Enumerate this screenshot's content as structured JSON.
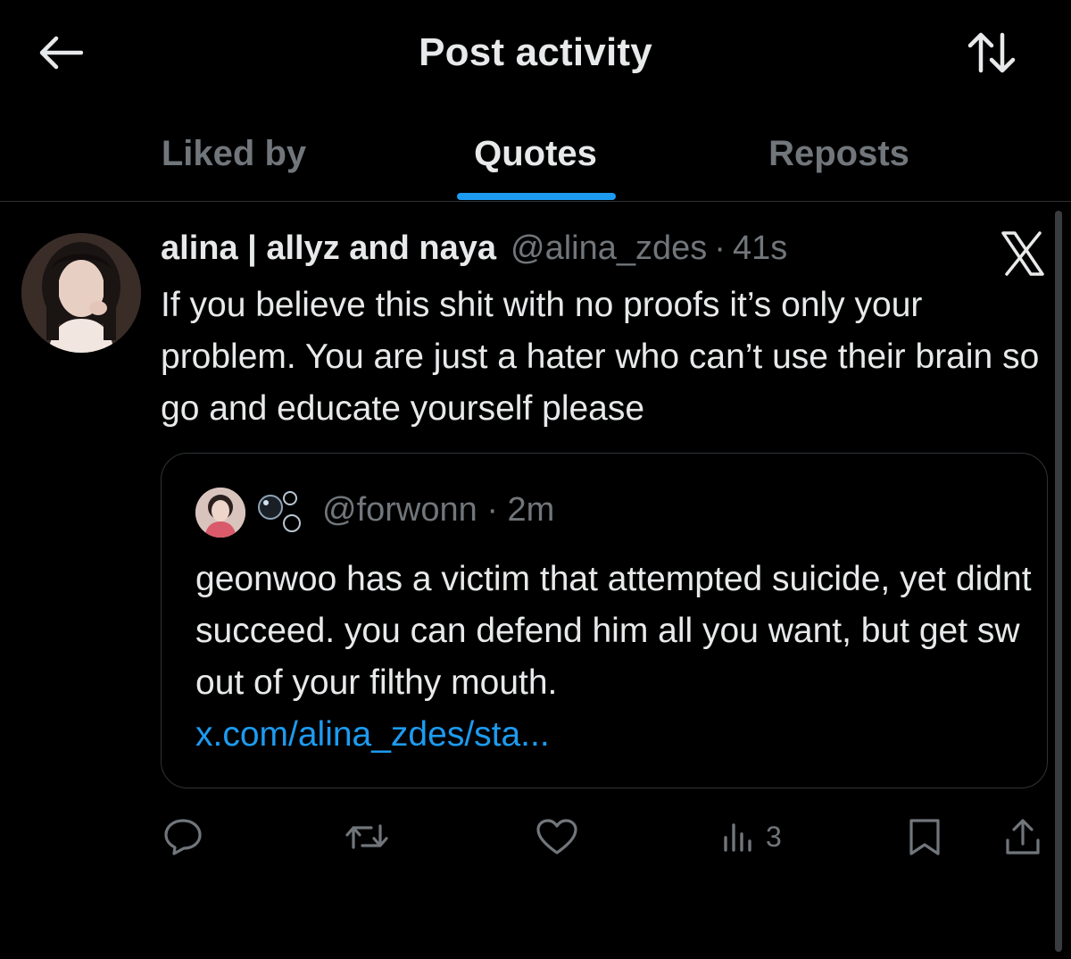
{
  "header": {
    "title": "Post activity",
    "back_icon": "arrow-left-icon",
    "sort_icon": "sort-arrows-icon"
  },
  "tabs": [
    {
      "label": "Liked by",
      "active": false
    },
    {
      "label": "Quotes",
      "active": true
    },
    {
      "label": "Reposts",
      "active": false
    }
  ],
  "post": {
    "display_name": "alina | allyz and naya",
    "handle": "@alina_zdes",
    "separator": "·",
    "time": "41s",
    "text": "If you believe this shit with no proofs it’s only your problem. You are just a hater who can’t use their brain so go and educate yourself please",
    "quoted": {
      "handle": "@forwonn",
      "separator": "·",
      "time": "2m",
      "text": "geonwoo has a victim that attempted suicide, yet didnt succeed. you can defend him all you want, but get sw out of your filthy mouth.",
      "link": "x.com/alina_zdes/sta..."
    },
    "actions": {
      "reply_icon": "reply-icon",
      "repost_icon": "repost-icon",
      "like_icon": "heart-icon",
      "views_icon": "views-icon",
      "views_count": "3",
      "bookmark_icon": "bookmark-icon",
      "share_icon": "share-icon"
    }
  },
  "colors": {
    "background": "#000000",
    "text": "#e7e9ea",
    "secondary": "#71767b",
    "accent": "#1d9bf0",
    "border": "#2f3336"
  }
}
